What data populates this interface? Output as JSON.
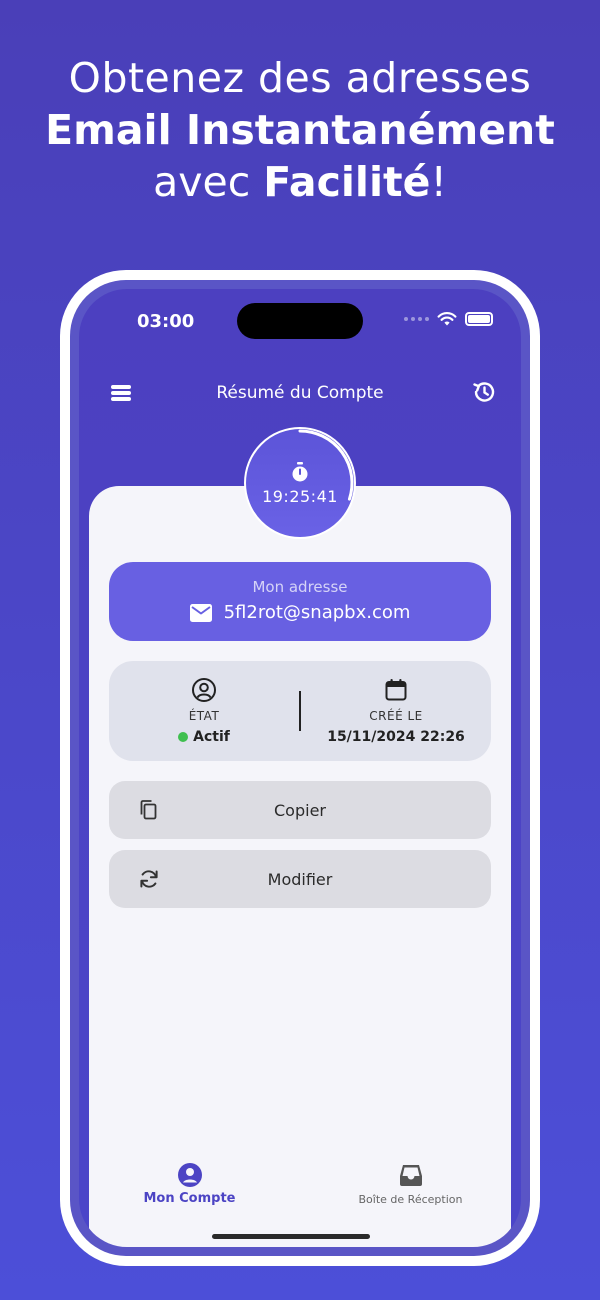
{
  "headline": {
    "line1": "Obtenez des adresses",
    "line2": "Email Instantanément",
    "line3_prefix": "avec ",
    "line3_bold": "Facilité",
    "line3_suffix": "!"
  },
  "status_bar": {
    "time": "03:00"
  },
  "header": {
    "title": "Résumé du Compte"
  },
  "timer": {
    "value": "19:25:41",
    "progress_fraction": 0.3
  },
  "address": {
    "label": "Mon adresse",
    "value": "5fl2rot@snapbx.com"
  },
  "info": {
    "status_label": "ÉTAT",
    "status_value": "Actif",
    "created_label": "CRÉÉ LE",
    "created_value": "15/11/2024 22:26"
  },
  "actions": {
    "copy": "Copier",
    "modify": "Modifier"
  },
  "nav": {
    "account": "Mon Compte",
    "inbox": "Boîte de Réception"
  },
  "colors": {
    "background": "#4a3fb8",
    "accent": "#6860e2",
    "active_nav": "#4c44c4",
    "status_active": "#3fbf4f"
  },
  "icons": {
    "menu": "menu-icon",
    "history": "history-icon",
    "timer": "stopwatch-icon",
    "mail": "mail-icon",
    "status": "user-circle-icon",
    "created": "calendar-icon",
    "copy": "copy-icon",
    "modify": "refresh-icon",
    "account": "account-icon",
    "inbox": "inbox-icon"
  }
}
